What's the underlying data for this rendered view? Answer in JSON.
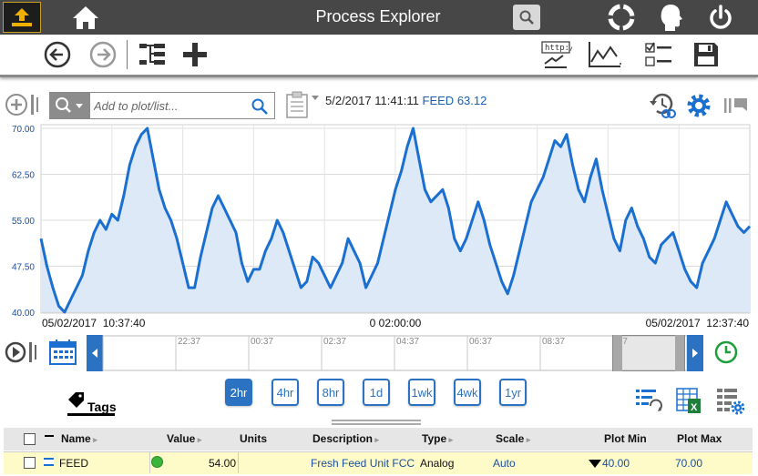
{
  "app": {
    "title": "Process Explorer"
  },
  "colors": {
    "accent": "#1a6fd0",
    "titlebar": "#474747",
    "selected_row": "#fffbc8",
    "status_good": "#3cb43c"
  },
  "cursor": {
    "timestamp": "5/2/2017 11:41:11",
    "tag": "FEED",
    "value": "63.12"
  },
  "search": {
    "placeholder": "Add to plot/list..."
  },
  "chart_data": {
    "type": "line",
    "title": "",
    "xlabel": "",
    "ylabel": "",
    "y_ticks": [
      "70.00",
      "62.50",
      "55.00",
      "47.50",
      "40.00"
    ],
    "ylim": [
      40,
      70
    ],
    "x_labels": {
      "left": "05/02/2017  10:37:40",
      "center": "0 02:00:00",
      "right": "05/02/2017  12:37:40"
    },
    "xlim": [
      "05/02/2017 10:37:40",
      "05/02/2017 12:37:40"
    ],
    "grid": true,
    "series": [
      {
        "x_minutes": [
          0,
          1,
          2,
          3,
          4,
          5,
          6,
          7,
          8,
          9,
          10,
          11,
          12,
          13,
          14,
          15,
          16,
          17,
          18,
          19,
          20,
          21,
          22,
          23,
          24,
          25,
          26,
          27,
          28,
          29,
          30,
          31,
          32,
          33,
          34,
          35,
          36,
          37,
          38,
          39,
          40,
          41,
          42,
          43,
          44,
          45,
          46,
          47,
          48,
          49,
          50,
          51,
          52,
          53,
          54,
          55,
          56,
          57,
          58,
          59,
          60,
          61,
          62,
          63,
          64,
          65,
          66,
          67,
          68,
          69,
          70,
          71,
          72,
          73,
          74,
          75,
          76,
          77,
          78,
          79,
          80,
          81,
          82,
          83,
          84,
          85,
          86,
          87,
          88,
          89,
          90,
          91,
          92,
          93,
          94,
          95,
          96,
          97,
          98,
          99,
          100,
          101,
          102,
          103,
          104,
          105,
          106,
          107,
          108,
          109,
          110,
          111,
          112,
          113,
          114,
          115,
          116,
          117,
          118,
          119,
          120
        ],
        "values": [
          52,
          47.5,
          44,
          41,
          40,
          42,
          44,
          46,
          50,
          53,
          55,
          53.5,
          56,
          55,
          59,
          64,
          67,
          69,
          70,
          65,
          60,
          57,
          55,
          52,
          48,
          44,
          44,
          49,
          53,
          57,
          59,
          57,
          55,
          53,
          48,
          45,
          47,
          47,
          50,
          52,
          55,
          53,
          50,
          47,
          44,
          45,
          49,
          48,
          46,
          44,
          46,
          48,
          52,
          50,
          48,
          44,
          46,
          48,
          52,
          56,
          60,
          63,
          67,
          70,
          65,
          60,
          58,
          59,
          60,
          57,
          52,
          50,
          52,
          55,
          58,
          55,
          51,
          48,
          45,
          43,
          46,
          50,
          54,
          58,
          60,
          62,
          65,
          68,
          67,
          69,
          64,
          60,
          58,
          62,
          65,
          60,
          56,
          52,
          50,
          55,
          57,
          54,
          52,
          49,
          48,
          51,
          52,
          53,
          50,
          47,
          45,
          44,
          48,
          50,
          52,
          55,
          58,
          56,
          54,
          53,
          54
        ]
      }
    ]
  },
  "timeline": {
    "ticks": [
      "22:37",
      "00:37",
      "02:37",
      "04:37",
      "06:37",
      "08:37",
      ":37"
    ]
  },
  "ranges": [
    {
      "label": "2hr",
      "active": true
    },
    {
      "label": "4hr",
      "active": false
    },
    {
      "label": "8hr",
      "active": false
    },
    {
      "label": "1d",
      "active": false
    },
    {
      "label": "1wk",
      "active": false
    },
    {
      "label": "4wk",
      "active": false
    },
    {
      "label": "1yr",
      "active": false
    }
  ],
  "tags_tab": {
    "label": "Tags"
  },
  "table": {
    "columns": [
      "Name",
      "Value",
      "Units",
      "Description",
      "Type",
      "Scale",
      "Plot Min",
      "Plot Max"
    ],
    "rows": [
      {
        "name": "FEED",
        "value": "54.00",
        "units": "",
        "description": "Fresh Feed Unit FCC",
        "type": "Analog",
        "scale": "Auto",
        "plot_min": "40.00",
        "plot_max": "70.00"
      }
    ]
  },
  "icons": [
    "upload-icon",
    "home-icon",
    "search-icon",
    "lifebuoy-icon",
    "profile-icon",
    "power-icon",
    "back-icon",
    "forward-icon",
    "hierarchy-icon",
    "add-icon",
    "http-icon",
    "trend-icon",
    "checklist-icon",
    "save-icon",
    "add-plot-icon",
    "clipboard-icon",
    "history-icon",
    "settings-icon",
    "pin-icon",
    "calendar-icon",
    "clock-icon",
    "tag-icon",
    "list-refresh-icon",
    "excel-icon",
    "table-settings-icon"
  ]
}
